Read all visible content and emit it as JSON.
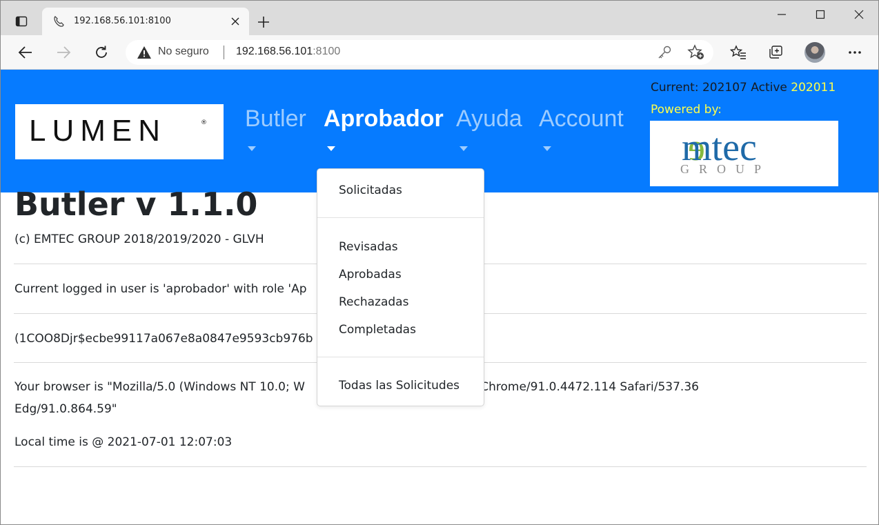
{
  "browser": {
    "tab_title": "192.168.56.101:8100",
    "security_label": "No seguro",
    "url_host": "192.168.56.101",
    "url_port": ":8100"
  },
  "header": {
    "logo_text": "LUMEN",
    "menus": [
      {
        "label": "Butler"
      },
      {
        "label": "Aprobador"
      },
      {
        "label": "Ayuda"
      },
      {
        "label": "Account"
      }
    ],
    "current_label": "Current: 202107 Active",
    "active_value": "202011",
    "powered_by": "Powered by:",
    "partner_logo_main": "emtec",
    "partner_logo_sub": "GROUP"
  },
  "content": {
    "title": "Butler v 1.1.0",
    "copyright": "(c) EMTEC GROUP 2018/2019/2020 - GLVH",
    "logged_user": "Current logged in user is 'aprobador' with role 'Ap",
    "token": "(1COO8Djr$ecbe99117a067e8a0847e9593cb976b",
    "browser_line1_a": "Your browser is \"Mozilla/5.0 (Windows NT 10.0; W",
    "browser_line1_b": "7.36 (KHTML, like Gecko) Chrome/91.0.4472.114 Safari/537.36",
    "browser_line2": "Edg/91.0.864.59\"",
    "local_time": "Local time is @ 2021-07-01 12:07:03"
  },
  "dropdown": {
    "items": [
      {
        "label": "Solicitadas"
      },
      {
        "label": "Revisadas"
      },
      {
        "label": "Aprobadas"
      },
      {
        "label": "Rechazadas"
      },
      {
        "label": "Completadas"
      },
      {
        "label": "Todas las Solicitudes"
      }
    ]
  },
  "colors": {
    "header_bg": "#067bff",
    "menu_inactive": "#9dccff",
    "highlight_yellow": "#ffff4a"
  }
}
